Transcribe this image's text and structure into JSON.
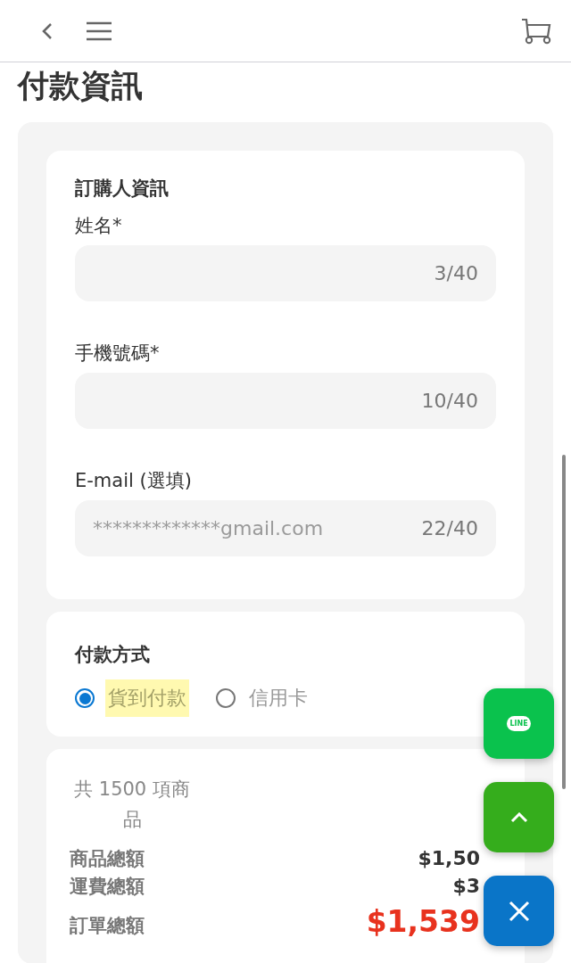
{
  "header": {
    "page_title": "付款資訊"
  },
  "buyer": {
    "title": "訂購人資訊",
    "fields": [
      {
        "label": "姓名*",
        "counter": "3/40"
      },
      {
        "label": "手機號碼*",
        "counter": "10/40"
      },
      {
        "label": "E-mail (選填)",
        "placeholder": "*************gmail.com",
        "counter": "22/40"
      }
    ]
  },
  "payment": {
    "title": "付款方式",
    "options": [
      {
        "label": "貨到付款",
        "selected": true
      },
      {
        "label": "信用卡",
        "selected": false
      }
    ]
  },
  "summary": {
    "count": "共 1500 項商品",
    "rows": [
      {
        "kind": "normal",
        "label": "商品總額",
        "value": "$1,50"
      },
      {
        "kind": "normal",
        "label": "運費總額",
        "value": "$3"
      },
      {
        "kind": "total",
        "label": "訂單總額",
        "value": "$1,539"
      }
    ]
  },
  "floating": [
    {
      "kind": "line",
      "label": "LINE"
    },
    {
      "kind": "up"
    },
    {
      "kind": "close"
    }
  ]
}
